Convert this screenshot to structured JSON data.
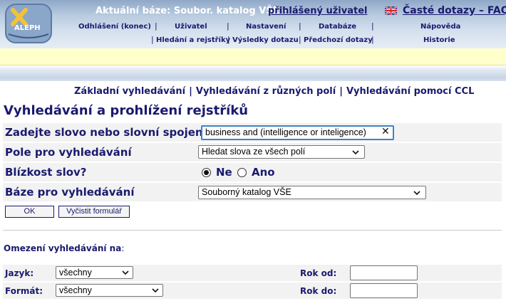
{
  "header": {
    "logo_text": "ALEPH",
    "current_base_text": "Aktuální báze: Soubor. katalog VŠE –",
    "logged_user_link": "přihlášený uživatel",
    "faq_link": "Časté dotazy – FAQ",
    "nav_row1": [
      "Odhlášení (konec)",
      "Uživatel",
      "Nastavení",
      "Databáze",
      "Nápověda"
    ],
    "nav_row2": [
      "Hledání a rejstříky",
      "Výsledky dotazu",
      "Předchozí dotazy",
      "Historie"
    ]
  },
  "tabs": [
    "Základní vyhledávání",
    "Vyhledávání z různých polí",
    "Vyhledávání pomocí CCL"
  ],
  "page_title": "Vyhledávání a prohlížení rejstříků",
  "form": {
    "search_label": "Zadejte slovo nebo slovní spojení",
    "search_value": "business and (intelligence or inteligence)",
    "field_label": "Pole pro vyhledávání",
    "field_value": "Hledat slova ze všech polí",
    "proximity_label": "Blízkost slov?",
    "proximity_options": [
      "Ne",
      "Ano"
    ],
    "proximity_selected": "Ne",
    "base_label": "Báze pro vyhledávání",
    "base_value": "Souborný katalog VŠE",
    "ok_button": "OK",
    "clear_button": "Vyčistit formulář"
  },
  "limits": {
    "title": "Omezení vyhledávání na",
    "title_suffix": ":",
    "language_label": "Jazyk:",
    "language_value": "všechny",
    "format_label": "Formát:",
    "format_value": "všechny",
    "year_from_label": "Rok od:",
    "year_from_value": "",
    "year_to_label": "Rok do:",
    "year_to_value": ""
  },
  "icons": {
    "logo": "aleph-logo",
    "flag": "uk-flag-icon",
    "clear": "clear-icon",
    "dropdown": "chevron-down-icon"
  }
}
